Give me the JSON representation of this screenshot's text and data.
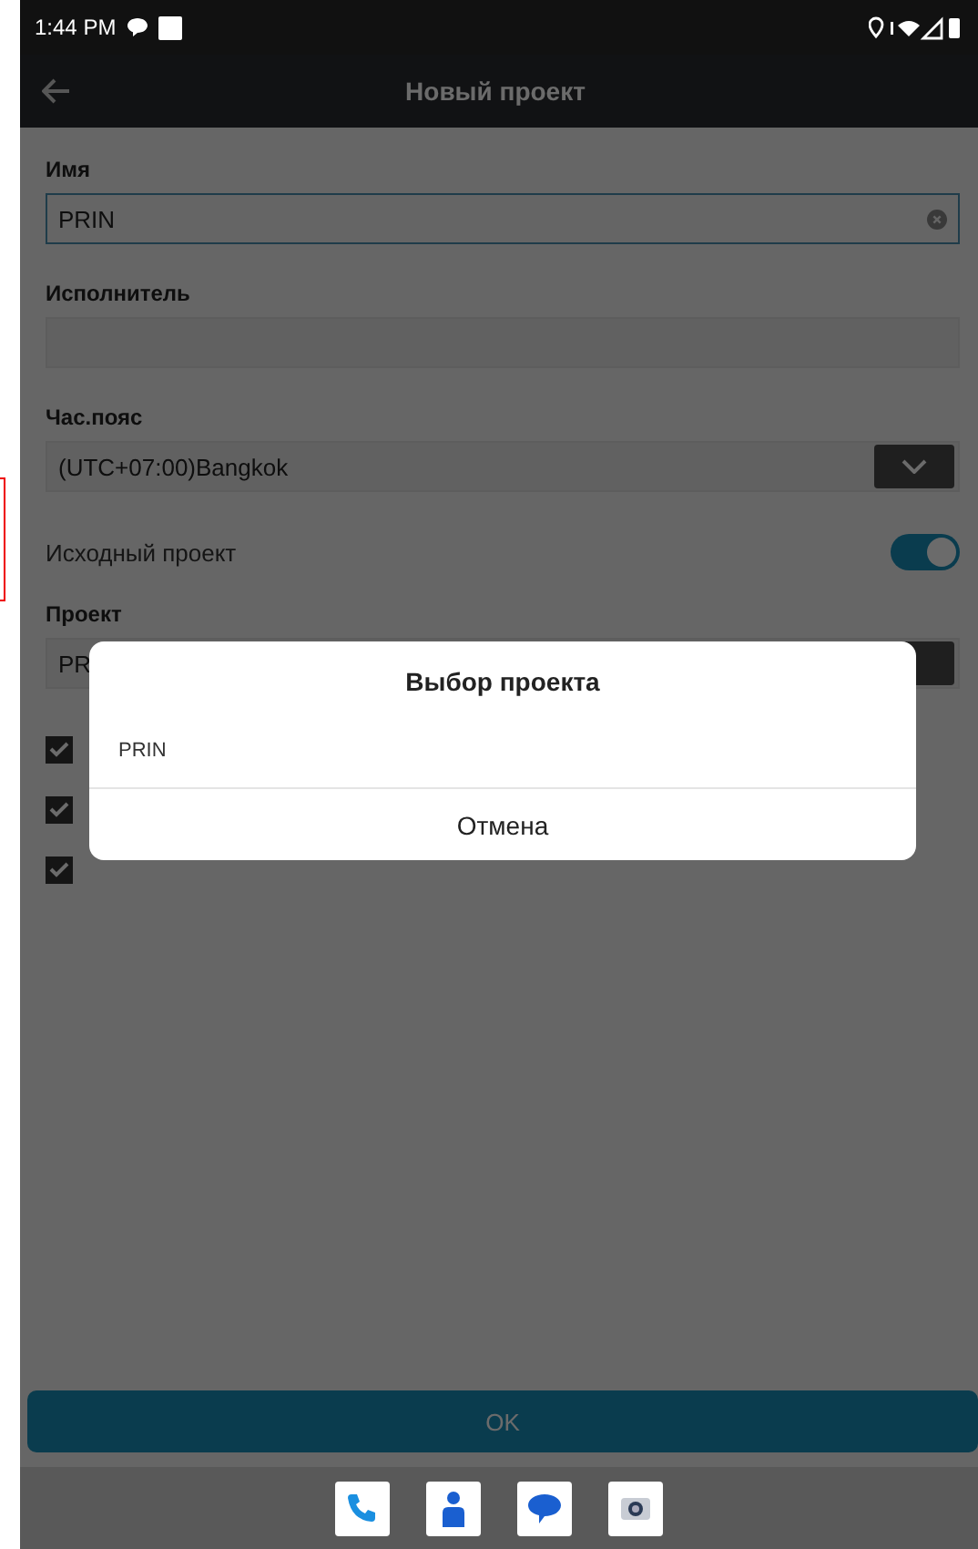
{
  "status_bar": {
    "time": "1:44 PM"
  },
  "app_bar": {
    "title": "Новый проект"
  },
  "form": {
    "name": {
      "label": "Имя",
      "value": "PRIN"
    },
    "executor": {
      "label": "Исполнитель"
    },
    "timezone": {
      "label": "Час.пояс",
      "value": "(UTC+07:00)Bangkok"
    },
    "source_project": {
      "label": "Исходный проект",
      "on": true
    },
    "project": {
      "label": "Проект",
      "value": "PR"
    },
    "checkboxes": [
      {
        "checked": true
      },
      {
        "checked": true
      },
      {
        "checked": true
      }
    ]
  },
  "dialog": {
    "title": "Выбор проекта",
    "items": [
      "PRIN"
    ],
    "cancel": "Отмена"
  },
  "ok_button": "OK"
}
